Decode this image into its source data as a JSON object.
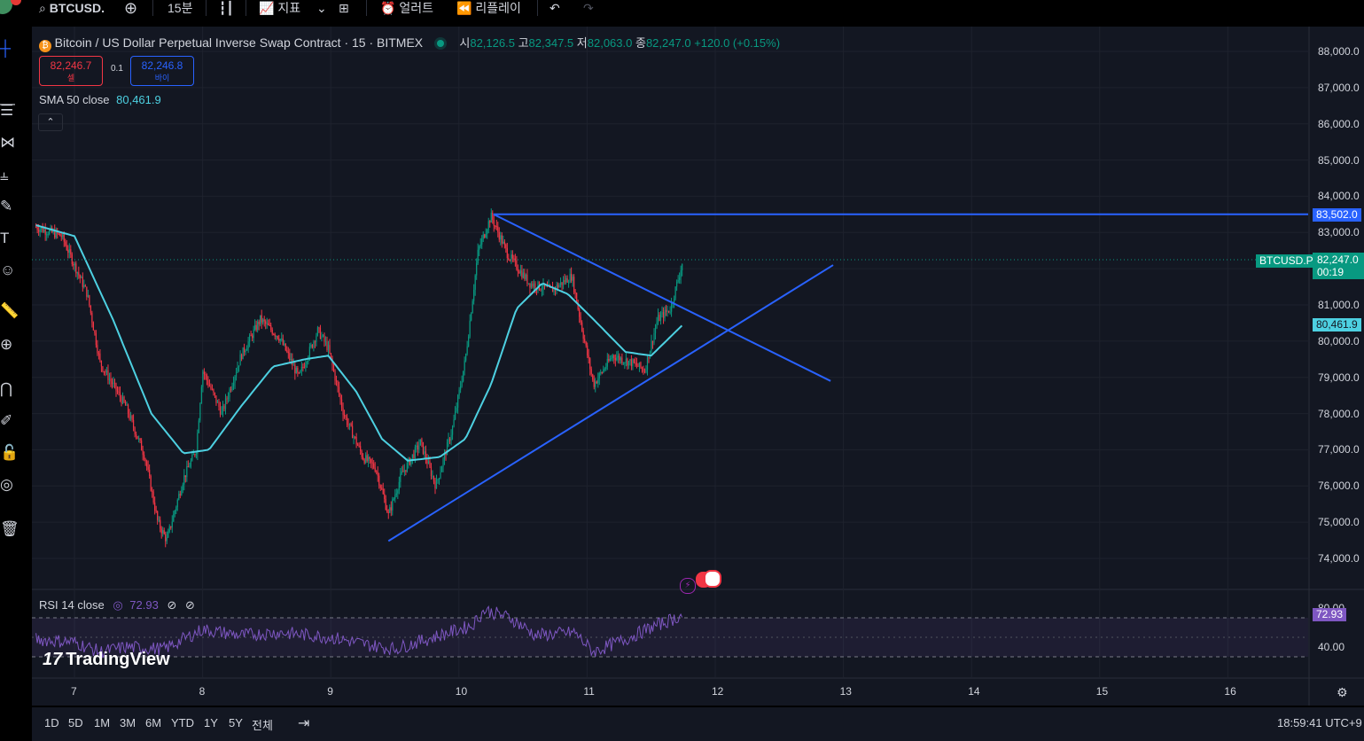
{
  "toolbar": {
    "symbol": "BTCUSD.P",
    "interval": "15분",
    "indicators_label": "지표",
    "alert_label": "얼러트",
    "replay_label": "리플레이"
  },
  "legend": {
    "title": "Bitcoin / US Dollar Perpetual Inverse Swap Contract · 15 · BITMEX",
    "open_label": "시",
    "open": "82,126.5",
    "high_label": "고",
    "high": "82,347.5",
    "low_label": "저",
    "low": "82,063.0",
    "close_label": "종",
    "close": "82,247.0",
    "change": "+120.0 (+0.15%)",
    "sell_price": "82,246.7",
    "sell_label": "셀",
    "spread": "0.1",
    "buy_price": "82,246.8",
    "buy_label": "바이",
    "sma_label": "SMA 50 close",
    "sma_value": "80,461.9",
    "rsi_label": "RSI 14 close",
    "rsi_value": "72.93"
  },
  "axis": {
    "price_labels": [
      "88,000.0",
      "87,000.0",
      "86,000.0",
      "85,000.0",
      "84,000.0",
      "83,000.0",
      "81,000.0",
      "80,000.0",
      "79,000.0",
      "78,000.0",
      "77,000.0",
      "76,000.0",
      "75,000.0",
      "74,000.0"
    ],
    "rsi_labels": [
      "80.00",
      "40.00"
    ],
    "date_labels": [
      "7",
      "8",
      "9",
      "10",
      "11",
      "12",
      "13",
      "14",
      "15",
      "16"
    ],
    "horizontal_line_label": "83,502.0",
    "last_price_symbol": "BTCUSD.P",
    "last_price": "82,247.0",
    "countdown": "00:19",
    "sma_tag": "80,461.9",
    "rsi_tag": "72.93"
  },
  "bottom": {
    "ranges": [
      "1D",
      "5D",
      "1M",
      "3M",
      "6M",
      "YTD",
      "1Y",
      "5Y",
      "전체"
    ],
    "clock": "18:59:41 UTC+9"
  },
  "brand": "TradingView",
  "chart_data": {
    "type": "candlestick",
    "title": "Bitcoin / US Dollar Perpetual Inverse Swap Contract · 15 · BITMEX",
    "x_axis": "date (day of month)",
    "ylim": [
      73500,
      88300
    ],
    "x_range_days": [
      6.65,
      16.6
    ],
    "price_anchor_points": [
      {
        "day": 6.7,
        "close": 83150
      },
      {
        "day": 6.9,
        "close": 82900
      },
      {
        "day": 7.1,
        "close": 81300
      },
      {
        "day": 7.2,
        "close": 79400
      },
      {
        "day": 7.4,
        "close": 78200
      },
      {
        "day": 7.55,
        "close": 76800
      },
      {
        "day": 7.65,
        "close": 75000
      },
      {
        "day": 7.72,
        "close": 74500
      },
      {
        "day": 7.85,
        "close": 76200
      },
      {
        "day": 7.95,
        "close": 77000
      },
      {
        "day": 8.0,
        "close": 79200
      },
      {
        "day": 8.15,
        "close": 78000
      },
      {
        "day": 8.3,
        "close": 79600
      },
      {
        "day": 8.45,
        "close": 80600
      },
      {
        "day": 8.6,
        "close": 80100
      },
      {
        "day": 8.75,
        "close": 79000
      },
      {
        "day": 8.9,
        "close": 80300
      },
      {
        "day": 8.98,
        "close": 79800
      },
      {
        "day": 9.1,
        "close": 78000
      },
      {
        "day": 9.25,
        "close": 76800
      },
      {
        "day": 9.35,
        "close": 76500
      },
      {
        "day": 9.45,
        "close": 75200
      },
      {
        "day": 9.55,
        "close": 76300
      },
      {
        "day": 9.7,
        "close": 77200
      },
      {
        "day": 9.82,
        "close": 76000
      },
      {
        "day": 9.95,
        "close": 77600
      },
      {
        "day": 10.05,
        "close": 79500
      },
      {
        "day": 10.15,
        "close": 82500
      },
      {
        "day": 10.25,
        "close": 83450
      },
      {
        "day": 10.38,
        "close": 82400
      },
      {
        "day": 10.55,
        "close": 81600
      },
      {
        "day": 10.72,
        "close": 81400
      },
      {
        "day": 10.88,
        "close": 81800
      },
      {
        "day": 10.98,
        "close": 80000
      },
      {
        "day": 11.05,
        "close": 78800
      },
      {
        "day": 11.2,
        "close": 79600
      },
      {
        "day": 11.35,
        "close": 79400
      },
      {
        "day": 11.45,
        "close": 79200
      },
      {
        "day": 11.55,
        "close": 80600
      },
      {
        "day": 11.65,
        "close": 80900
      },
      {
        "day": 11.75,
        "close": 82247
      }
    ],
    "sma_anchor_points": [
      {
        "day": 6.7,
        "value": 83200
      },
      {
        "day": 7.0,
        "value": 82900
      },
      {
        "day": 7.3,
        "value": 80600
      },
      {
        "day": 7.6,
        "value": 78000
      },
      {
        "day": 7.85,
        "value": 76900
      },
      {
        "day": 8.05,
        "value": 77000
      },
      {
        "day": 8.3,
        "value": 78200
      },
      {
        "day": 8.55,
        "value": 79300
      },
      {
        "day": 8.8,
        "value": 79500
      },
      {
        "day": 8.98,
        "value": 79600
      },
      {
        "day": 9.2,
        "value": 78600
      },
      {
        "day": 9.4,
        "value": 77300
      },
      {
        "day": 9.6,
        "value": 76700
      },
      {
        "day": 9.85,
        "value": 76800
      },
      {
        "day": 10.05,
        "value": 77300
      },
      {
        "day": 10.25,
        "value": 78800
      },
      {
        "day": 10.45,
        "value": 80900
      },
      {
        "day": 10.65,
        "value": 81600
      },
      {
        "day": 10.85,
        "value": 81300
      },
      {
        "day": 11.05,
        "value": 80600
      },
      {
        "day": 11.3,
        "value": 79700
      },
      {
        "day": 11.5,
        "value": 79600
      },
      {
        "day": 11.75,
        "value": 80462
      }
    ],
    "rsi_anchor_points": [
      {
        "day": 6.7,
        "value": 48
      },
      {
        "day": 7.0,
        "value": 45
      },
      {
        "day": 7.2,
        "value": 35
      },
      {
        "day": 7.4,
        "value": 40
      },
      {
        "day": 7.7,
        "value": 38
      },
      {
        "day": 8.0,
        "value": 58
      },
      {
        "day": 8.3,
        "value": 52
      },
      {
        "day": 8.6,
        "value": 55
      },
      {
        "day": 9.0,
        "value": 50
      },
      {
        "day": 9.3,
        "value": 42
      },
      {
        "day": 9.5,
        "value": 38
      },
      {
        "day": 9.8,
        "value": 50
      },
      {
        "day": 10.1,
        "value": 62
      },
      {
        "day": 10.2,
        "value": 78
      },
      {
        "day": 10.4,
        "value": 70
      },
      {
        "day": 10.6,
        "value": 52
      },
      {
        "day": 10.9,
        "value": 55
      },
      {
        "day": 11.05,
        "value": 35
      },
      {
        "day": 11.3,
        "value": 48
      },
      {
        "day": 11.5,
        "value": 60
      },
      {
        "day": 11.75,
        "value": 72.93
      }
    ],
    "rsi_levels": [
      70,
      30
    ],
    "horizontal_line": 83502,
    "trendlines": [
      {
        "from": {
          "day": 10.27,
          "price": 83502
        },
        "to": {
          "day": 12.9,
          "price": 78900
        }
      },
      {
        "from": {
          "day": 9.45,
          "price": 74480
        },
        "to": {
          "day": 12.92,
          "price": 82100
        }
      }
    ],
    "last_price": 82247,
    "sma_period": 50,
    "rsi_period": 14
  }
}
